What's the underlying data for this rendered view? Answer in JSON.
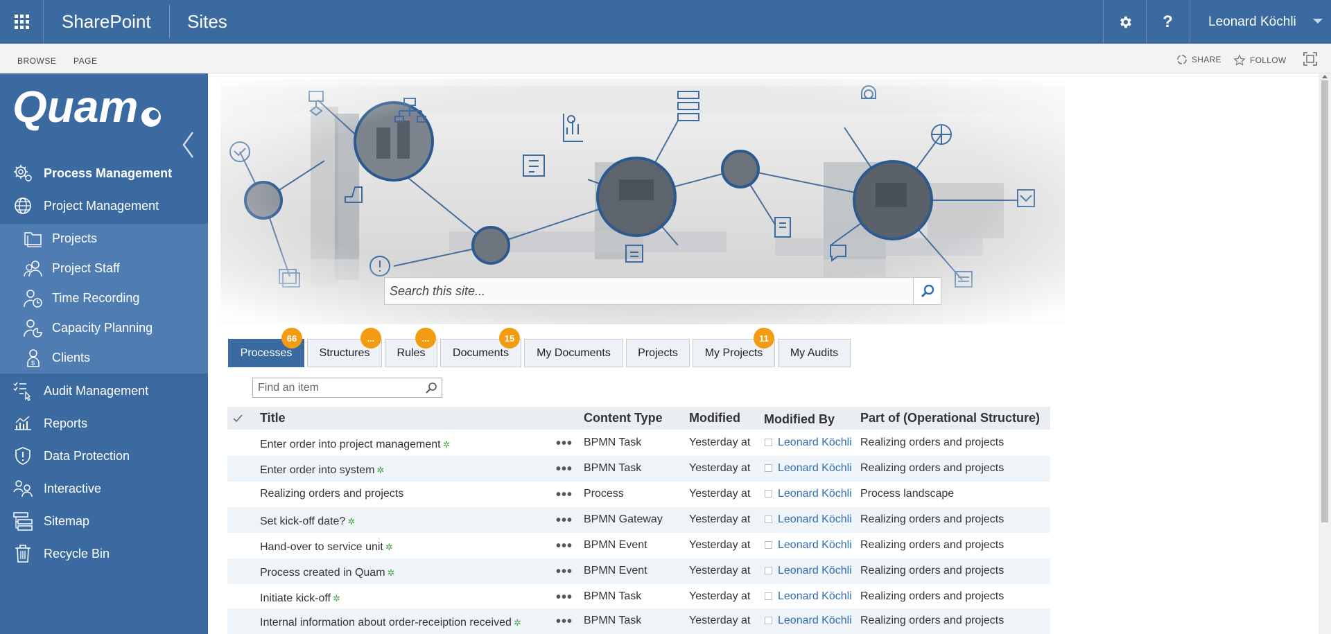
{
  "suitebar": {
    "brand": "SharePoint",
    "section": "Sites",
    "settings_icon": "gear-icon",
    "help_label": "?",
    "user_name": "Leonard Köchli"
  },
  "ribbon": {
    "tabs": [
      "BROWSE",
      "PAGE"
    ],
    "share": "SHARE",
    "follow": "FOLLOW"
  },
  "nav": {
    "logo_text": "Quam",
    "items": [
      {
        "label": "Process Management",
        "icon": "gears-icon"
      },
      {
        "label": "Project Management",
        "icon": "globe-icon"
      },
      {
        "label": "Audit Management",
        "icon": "checklist-icon"
      },
      {
        "label": "Reports",
        "icon": "chart-icon"
      },
      {
        "label": "Data Protection",
        "icon": "shield-icon"
      },
      {
        "label": "Interactive",
        "icon": "people-icon"
      },
      {
        "label": "Sitemap",
        "icon": "sitemap-icon"
      },
      {
        "label": "Recycle Bin",
        "icon": "trash-icon"
      }
    ],
    "subitems": [
      {
        "label": "Projects",
        "icon": "folders-icon"
      },
      {
        "label": "Project Staff",
        "icon": "staff-icon"
      },
      {
        "label": "Time Recording",
        "icon": "time-icon"
      },
      {
        "label": "Capacity Planning",
        "icon": "capacity-icon"
      },
      {
        "label": "Clients",
        "icon": "client-icon"
      }
    ]
  },
  "hero": {
    "search_placeholder": "Search this site..."
  },
  "tabs": [
    {
      "label": "Processes",
      "badge": "66",
      "active": true
    },
    {
      "label": "Structures",
      "badge": "...",
      "active": false
    },
    {
      "label": "Rules",
      "badge": "...",
      "active": false
    },
    {
      "label": "Documents",
      "badge": "15",
      "active": false
    },
    {
      "label": "My Documents",
      "badge": "",
      "active": false
    },
    {
      "label": "Projects",
      "badge": "",
      "active": false
    },
    {
      "label": "My Projects",
      "badge": "11",
      "active": false
    },
    {
      "label": "My Audits",
      "badge": "",
      "active": false
    }
  ],
  "find": {
    "placeholder": "Find an item"
  },
  "table": {
    "columns": [
      "Title",
      "Content Type",
      "Modified",
      "Modified By",
      "Part of (Operational Structure)"
    ],
    "rows": [
      {
        "title": "Enter order into project management",
        "new": true,
        "type": "BPMN Task",
        "modified": "Yesterday at",
        "by": "Leonard Köchli",
        "part": "Realizing orders and projects"
      },
      {
        "title": "Enter order into system",
        "new": true,
        "type": "BPMN Task",
        "modified": "Yesterday at",
        "by": "Leonard Köchli",
        "part": "Realizing orders and projects"
      },
      {
        "title": "Realizing orders and projects",
        "new": false,
        "type": "Process",
        "modified": "Yesterday at",
        "by": "Leonard Köchli",
        "part": "Process landscape"
      },
      {
        "title": "Set kick-off date?",
        "new": true,
        "type": "BPMN Gateway",
        "modified": "Yesterday at",
        "by": "Leonard Köchli",
        "part": "Realizing orders and projects"
      },
      {
        "title": "Hand-over to service unit",
        "new": true,
        "type": "BPMN Event",
        "modified": "Yesterday at",
        "by": "Leonard Köchli",
        "part": "Realizing orders and projects"
      },
      {
        "title": "Process created in Quam",
        "new": true,
        "type": "BPMN Event",
        "modified": "Yesterday at",
        "by": "Leonard Köchli",
        "part": "Realizing orders and projects"
      },
      {
        "title": "Initiate kick-off",
        "new": true,
        "type": "BPMN Task",
        "modified": "Yesterday at",
        "by": "Leonard Köchli",
        "part": "Realizing orders and projects"
      },
      {
        "title": "Internal information about order-receiption received",
        "new": true,
        "type": "BPMN Task",
        "modified": "Yesterday at",
        "by": "Leonard Köchli",
        "part": "Realizing orders and projects"
      }
    ]
  },
  "colors": {
    "brand_blue": "#3a6aa0",
    "subnav_blue": "#4f7db2",
    "badge_orange": "#f39c12",
    "link_blue": "#2e6db4",
    "new_green": "#4aa34a"
  }
}
